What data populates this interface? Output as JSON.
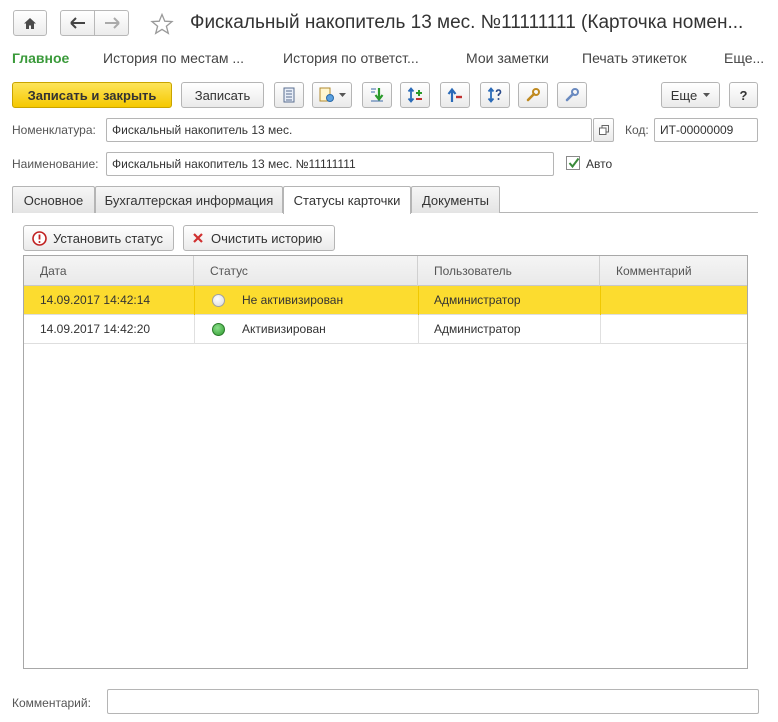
{
  "window": {
    "title": "Фискальный накопитель 13 мес. №11111111 (Карточка номен..."
  },
  "sections": {
    "items": [
      {
        "label": "Главное",
        "active": true
      },
      {
        "label": "История по местам ..."
      },
      {
        "label": "История по ответст..."
      },
      {
        "label": "Мои заметки"
      },
      {
        "label": "Печать этикеток"
      },
      {
        "label": "Еще..."
      }
    ]
  },
  "toolbar": {
    "save_close": "Записать и закрыть",
    "save": "Записать",
    "more": "Еще",
    "help": "?"
  },
  "form": {
    "nomenclature_label": "Номенклатура:",
    "nomenclature_value": "Фискальный накопитель 13 мес.",
    "code_label": "Код:",
    "code_value": "ИТ-00000009",
    "name_label": "Наименование:",
    "name_value": "Фискальный накопитель 13 мес. №11111111",
    "auto_label": "Авто",
    "auto_checked": true,
    "comment_label": "Комментарий:",
    "comment_value": ""
  },
  "tabs": [
    {
      "label": "Основное"
    },
    {
      "label": "Бухгалтерская информация"
    },
    {
      "label": "Статусы карточки",
      "active": true
    },
    {
      "label": "Документы"
    }
  ],
  "status_panel": {
    "set_status": "Установить статус",
    "clear_history": "Очистить историю"
  },
  "table": {
    "columns": [
      "Дата",
      "Статус",
      "Пользователь",
      "Комментарий"
    ],
    "rows": [
      {
        "date": "14.09.2017 14:42:14",
        "status": "Не активизирован",
        "status_color": "#ffffff",
        "user": "Администратор",
        "comment": "",
        "selected": true
      },
      {
        "date": "14.09.2017 14:42:20",
        "status": "Активизирован",
        "status_color": "#3aaa3a",
        "user": "Администратор",
        "comment": "",
        "selected": false
      }
    ]
  },
  "colors": {
    "accent_yellow": "#f5c800",
    "selected_row": "#fcdc2f",
    "active_section": "#3a9a3a"
  }
}
